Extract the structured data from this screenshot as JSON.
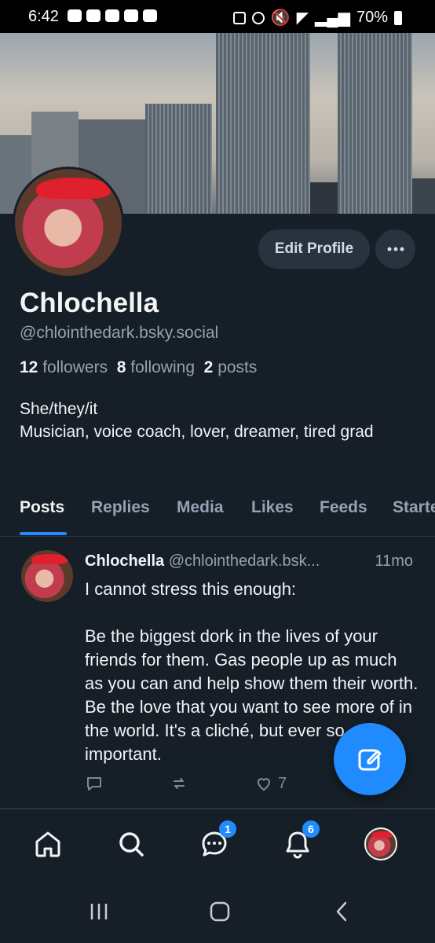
{
  "status_bar": {
    "time": "6:42",
    "battery": "70%",
    "icons": [
      "chat-icon",
      "discord-icon",
      "discord-icon",
      "discord-icon",
      "calendar-icon",
      "nfc-icon",
      "alarm-icon",
      "mute-icon",
      "wifi-icon",
      "signal-icon",
      "battery-icon"
    ]
  },
  "profile": {
    "display_name": "Chlochella",
    "handle": "@chlointhedark.bsky.social",
    "followers_count": "12",
    "followers_label": "followers",
    "following_count": "8",
    "following_label": "following",
    "posts_count": "2",
    "posts_label": "posts",
    "bio": "She/they/it\nMusician, voice coach, lover, dreamer, tired grad",
    "edit_button": "Edit Profile",
    "more_button": "⋯"
  },
  "tabs": [
    "Posts",
    "Replies",
    "Media",
    "Likes",
    "Feeds",
    "Starter Packs"
  ],
  "active_tab": "Posts",
  "post": {
    "author_name": "Chlochella",
    "author_handle": "@chlointhedark.bsk...",
    "time": "11mo",
    "text": "I cannot stress this enough:\n\nBe the biggest dork in the lives of your friends for them. Gas people up as much as you can and help show them their worth. Be the love that you want to see more of in the world. It's a cliché, but ever so important.",
    "like_count": "7"
  },
  "bottom_nav": {
    "messages_badge": "1",
    "notifications_badge": "6"
  },
  "colors": {
    "background": "#161e27",
    "accent": "#208bfe",
    "muted_text": "#94a2b2",
    "button_bg": "#283340"
  }
}
